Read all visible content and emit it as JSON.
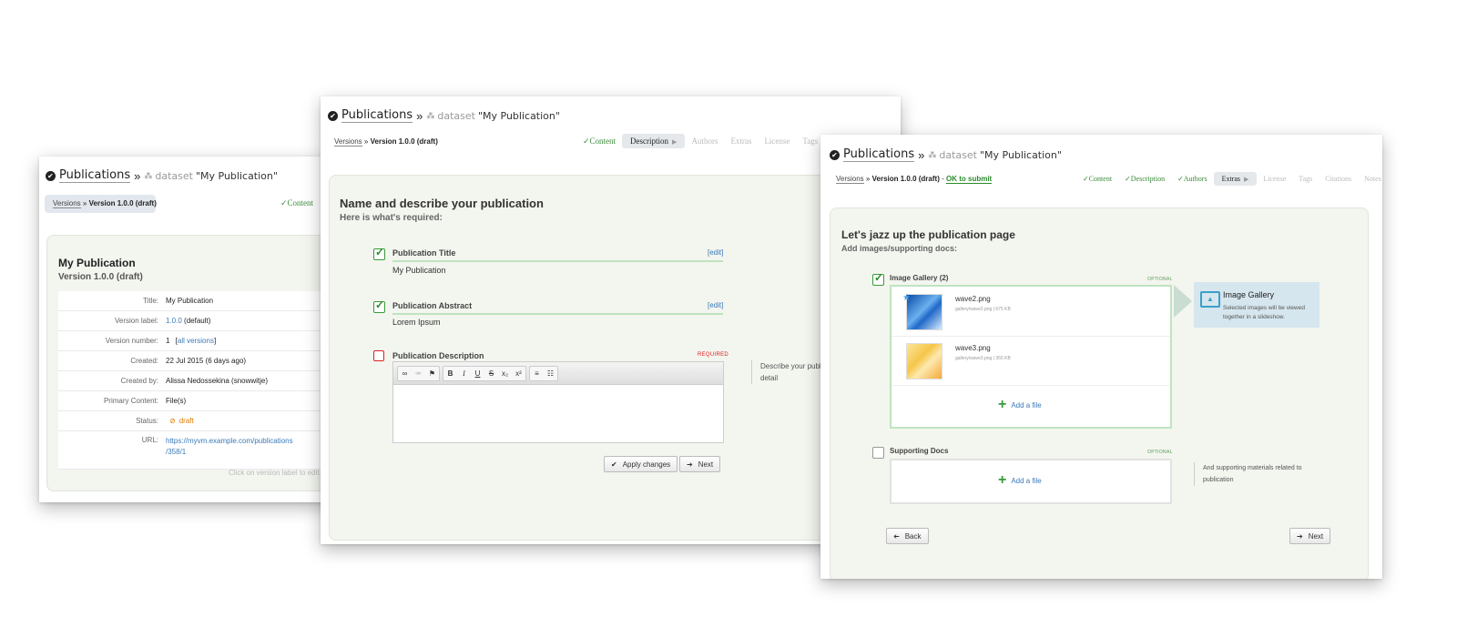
{
  "header": {
    "publications": "Publications",
    "raquo": "»",
    "dataset_label": "dataset",
    "dataset_name": "\"My Publication\""
  },
  "crumb": {
    "versions": "Versions",
    "sep": "»",
    "version": "Version 1.0.0 (draft)",
    "dash": "-",
    "ok": "OK to submit"
  },
  "win1": {
    "tab_content": "Content",
    "title": "My Publication",
    "subtitle": "Version 1.0.0 (draft)",
    "rows": [
      {
        "k": "Title:",
        "v": "My Publication"
      },
      {
        "k": "Version label:",
        "link": "1.0.0",
        "v": "(default)"
      },
      {
        "k": "Version number:",
        "v": "1",
        "bracket_open": "[",
        "link": "all versions",
        "bracket_close": "]"
      },
      {
        "k": "Created:",
        "v": "22 Jul 2015 (6 days ago)"
      },
      {
        "k": "Created by:",
        "v": "Alissa Nedossekina (snowwitje)"
      },
      {
        "k": "Primary Content:",
        "v": "File(s)"
      },
      {
        "k": "Status:",
        "v": "draft"
      },
      {
        "k": "URL:",
        "link": "https://myvm.example.com/publications",
        "link2": "/358/1"
      }
    ],
    "hint": "Click on version label to edit."
  },
  "win2": {
    "tabs": [
      "Content",
      "Description",
      "Authors",
      "Extras",
      "License",
      "Tags"
    ],
    "heading": "Name and describe your publication",
    "subheading": "Here is what's required:",
    "fields": {
      "title_label": "Publication Title",
      "title_value": "My Publication",
      "abstract_label": "Publication Abstract",
      "abstract_value": "Lorem Ipsum",
      "desc_label": "Publication Description",
      "edit": "[edit]",
      "required": "REQUIRED"
    },
    "sidehint_1": "Describe your publ",
    "sidehint_2": "detail",
    "apply_btn": "Apply changes",
    "next_btn": "Next"
  },
  "win3": {
    "tabs": [
      "Content",
      "Description",
      "Authors",
      "Extras",
      "License",
      "Tags",
      "Citations",
      "Notes"
    ],
    "heading": "Let's jazz up the publication page",
    "subheading": "Add images/supporting docs:",
    "gallery_label": "Image Gallery (2)",
    "optional": "OPTIONAL",
    "files": [
      {
        "name": "wave2.png",
        "meta": "gallery/wave2.png | 675 KB"
      },
      {
        "name": "wave3.png",
        "meta": "gallery/wave3.png | 355 KB"
      }
    ],
    "add_file": "Add a file",
    "info_title": "Image Gallery",
    "info_desc": "Selected images will be viewed together in a slideshow.",
    "supporting_label": "Supporting Docs",
    "supporting_hint": "And supporting materials related to publication",
    "back_btn": "Back",
    "next_btn": "Next"
  },
  "colors": {
    "done_tab": "#3a8a3a",
    "link": "#3a7ab8",
    "draft": "#e07b00",
    "required": "#dd2222",
    "panel_bg": "#f3f5ef"
  }
}
